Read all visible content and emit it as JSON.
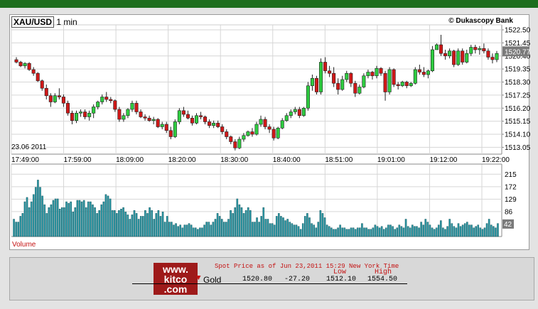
{
  "header": {
    "symbol": "XAU/USD",
    "interval": "1 min",
    "copyright": "© Dukascopy Bank",
    "date": "23.06 2011",
    "volume_label": "Volume"
  },
  "colors": {
    "up": "#2ecc40",
    "down": "#d01818",
    "volume": "#2a9aa8",
    "topbar": "#1d6e1d",
    "brand": "#9e1a1a"
  },
  "chart_data": [
    {
      "type": "candlestick",
      "title": "XAU/USD 1 min",
      "x_ticks": [
        "17:49:00",
        "17:59:00",
        "18:09:00",
        "18:20:00",
        "18:30:00",
        "18:40:00",
        "18:51:00",
        "19:01:00",
        "19:12:00",
        "19:22:00"
      ],
      "y_ticks": [
        "1522.50",
        "1521.45",
        "1520.40",
        "1519.35",
        "1518.30",
        "1517.25",
        "1516.20",
        "1515.15",
        "1514.10",
        "1513.05"
      ],
      "ylim": [
        1512.5,
        1522.9
      ],
      "last_price": "1520.77",
      "grid": true,
      "candles": [
        [
          1520.1,
          1520.3,
          1519.8,
          1519.9
        ],
        [
          1519.9,
          1520.0,
          1519.5,
          1519.6
        ],
        [
          1519.6,
          1519.9,
          1519.4,
          1519.8
        ],
        [
          1519.8,
          1519.9,
          1519.2,
          1519.3
        ],
        [
          1519.3,
          1519.5,
          1518.8,
          1519.0
        ],
        [
          1519.0,
          1519.1,
          1518.3,
          1518.4
        ],
        [
          1518.4,
          1518.5,
          1517.6,
          1517.8
        ],
        [
          1517.8,
          1518.1,
          1516.9,
          1517.2
        ],
        [
          1517.2,
          1517.4,
          1516.3,
          1516.7
        ],
        [
          1516.7,
          1517.4,
          1516.6,
          1517.2
        ],
        [
          1517.2,
          1517.8,
          1516.9,
          1517.1
        ],
        [
          1517.1,
          1517.3,
          1516.3,
          1516.6
        ],
        [
          1516.6,
          1516.8,
          1515.6,
          1515.8
        ],
        [
          1515.8,
          1516.0,
          1514.9,
          1515.2
        ],
        [
          1515.2,
          1516.0,
          1515.0,
          1515.8
        ],
        [
          1515.8,
          1516.1,
          1515.5,
          1515.9
        ],
        [
          1515.9,
          1516.1,
          1515.3,
          1515.5
        ],
        [
          1515.5,
          1516.0,
          1515.2,
          1515.8
        ],
        [
          1515.8,
          1516.5,
          1515.4,
          1516.3
        ],
        [
          1516.3,
          1516.8,
          1516.1,
          1516.7
        ],
        [
          1516.7,
          1517.3,
          1516.5,
          1517.1
        ],
        [
          1517.1,
          1517.5,
          1516.7,
          1516.9
        ],
        [
          1516.9,
          1517.1,
          1516.6,
          1516.8
        ],
        [
          1516.8,
          1516.9,
          1515.9,
          1516.1
        ],
        [
          1516.1,
          1516.3,
          1515.1,
          1515.3
        ],
        [
          1515.3,
          1515.8,
          1515.1,
          1515.6
        ],
        [
          1515.6,
          1516.2,
          1515.4,
          1516.1
        ],
        [
          1516.1,
          1516.8,
          1515.9,
          1516.6
        ],
        [
          1516.6,
          1516.8,
          1515.7,
          1515.9
        ],
        [
          1515.9,
          1516.1,
          1515.4,
          1515.5
        ],
        [
          1515.5,
          1515.7,
          1515.2,
          1515.4
        ],
        [
          1515.4,
          1515.6,
          1515.1,
          1515.2
        ],
        [
          1515.2,
          1515.5,
          1514.9,
          1515.3
        ],
        [
          1515.3,
          1515.4,
          1514.6,
          1514.7
        ],
        [
          1514.7,
          1515.1,
          1514.5,
          1514.9
        ],
        [
          1514.9,
          1515.1,
          1514.2,
          1514.4
        ],
        [
          1514.4,
          1514.7,
          1513.7,
          1513.9
        ],
        [
          1513.9,
          1515.3,
          1513.8,
          1515.1
        ],
        [
          1515.1,
          1516.2,
          1514.9,
          1516.0
        ],
        [
          1516.0,
          1516.3,
          1515.5,
          1515.7
        ],
        [
          1515.7,
          1516.0,
          1515.3,
          1515.4
        ],
        [
          1515.4,
          1515.6,
          1514.8,
          1515.0
        ],
        [
          1515.0,
          1515.8,
          1514.9,
          1515.6
        ],
        [
          1515.6,
          1515.9,
          1515.3,
          1515.5
        ],
        [
          1515.5,
          1515.6,
          1514.9,
          1515.1
        ],
        [
          1515.1,
          1515.3,
          1514.6,
          1514.8
        ],
        [
          1514.8,
          1515.2,
          1514.6,
          1515.0
        ],
        [
          1515.0,
          1515.2,
          1514.6,
          1514.7
        ],
        [
          1514.7,
          1514.9,
          1514.1,
          1514.3
        ],
        [
          1514.3,
          1514.5,
          1513.7,
          1513.9
        ],
        [
          1513.9,
          1514.0,
          1513.3,
          1513.5
        ],
        [
          1513.5,
          1513.7,
          1512.8,
          1513.0
        ],
        [
          1513.0,
          1513.9,
          1512.9,
          1513.7
        ],
        [
          1513.7,
          1514.2,
          1513.5,
          1514.0
        ],
        [
          1514.0,
          1514.4,
          1513.9,
          1514.3
        ],
        [
          1514.3,
          1514.6,
          1513.9,
          1514.1
        ],
        [
          1514.1,
          1515.1,
          1514.0,
          1514.9
        ],
        [
          1514.9,
          1515.6,
          1514.7,
          1515.3
        ],
        [
          1515.3,
          1515.5,
          1514.5,
          1514.7
        ],
        [
          1514.7,
          1514.9,
          1514.2,
          1514.5
        ],
        [
          1514.5,
          1514.7,
          1513.6,
          1513.8
        ],
        [
          1513.8,
          1514.7,
          1513.7,
          1514.6
        ],
        [
          1514.6,
          1515.4,
          1514.5,
          1515.2
        ],
        [
          1515.2,
          1515.8,
          1515.1,
          1515.6
        ],
        [
          1515.6,
          1516.1,
          1515.4,
          1515.9
        ],
        [
          1515.9,
          1516.3,
          1515.7,
          1516.1
        ],
        [
          1516.1,
          1516.3,
          1515.4,
          1515.6
        ],
        [
          1515.6,
          1516.3,
          1515.5,
          1516.2
        ],
        [
          1516.2,
          1518.3,
          1516.0,
          1518.0
        ],
        [
          1518.0,
          1518.9,
          1517.6,
          1518.6
        ],
        [
          1518.6,
          1518.8,
          1517.3,
          1517.5
        ],
        [
          1517.5,
          1520.2,
          1517.3,
          1519.9
        ],
        [
          1519.9,
          1520.3,
          1519.0,
          1519.2
        ],
        [
          1519.2,
          1519.6,
          1518.7,
          1519.0
        ],
        [
          1519.0,
          1519.5,
          1517.9,
          1518.2
        ],
        [
          1518.2,
          1518.6,
          1517.3,
          1517.7
        ],
        [
          1517.7,
          1518.8,
          1517.6,
          1518.5
        ],
        [
          1518.5,
          1519.2,
          1518.3,
          1519.0
        ],
        [
          1519.0,
          1519.1,
          1517.9,
          1518.2
        ],
        [
          1518.2,
          1518.4,
          1517.1,
          1517.4
        ],
        [
          1517.4,
          1518.1,
          1517.3,
          1517.9
        ],
        [
          1517.9,
          1519.0,
          1517.8,
          1518.8
        ],
        [
          1518.8,
          1519.3,
          1518.6,
          1519.1
        ],
        [
          1519.1,
          1519.2,
          1518.5,
          1518.8
        ],
        [
          1518.8,
          1519.6,
          1518.6,
          1519.4
        ],
        [
          1519.4,
          1519.5,
          1518.8,
          1519.0
        ],
        [
          1519.0,
          1519.2,
          1516.8,
          1517.5
        ],
        [
          1517.5,
          1519.5,
          1517.3,
          1519.3
        ],
        [
          1519.3,
          1519.4,
          1517.9,
          1518.1
        ],
        [
          1518.1,
          1518.3,
          1517.7,
          1518.0
        ],
        [
          1518.0,
          1518.4,
          1517.9,
          1518.3
        ],
        [
          1518.3,
          1518.4,
          1517.8,
          1518.0
        ],
        [
          1518.0,
          1518.3,
          1517.9,
          1518.2
        ],
        [
          1518.2,
          1519.5,
          1518.1,
          1519.3
        ],
        [
          1519.3,
          1519.7,
          1518.9,
          1519.1
        ],
        [
          1519.1,
          1519.5,
          1518.7,
          1518.9
        ],
        [
          1518.9,
          1519.3,
          1518.6,
          1519.2
        ],
        [
          1519.2,
          1521.2,
          1519.1,
          1520.9
        ],
        [
          1520.9,
          1521.4,
          1521.0,
          1521.3
        ],
        [
          1521.3,
          1522.1,
          1520.4,
          1520.6
        ],
        [
          1520.6,
          1520.9,
          1520.1,
          1520.4
        ],
        [
          1520.4,
          1521.0,
          1520.2,
          1520.8
        ],
        [
          1520.8,
          1520.9,
          1519.5,
          1519.7
        ],
        [
          1519.7,
          1521.0,
          1519.6,
          1520.8
        ],
        [
          1520.8,
          1521.0,
          1519.7,
          1519.9
        ],
        [
          1519.9,
          1520.9,
          1519.8,
          1520.6
        ],
        [
          1520.6,
          1521.3,
          1520.4,
          1521.1
        ],
        [
          1521.1,
          1521.3,
          1520.6,
          1520.9
        ],
        [
          1520.9,
          1521.2,
          1520.5,
          1521.0
        ],
        [
          1521.0,
          1521.4,
          1520.6,
          1520.8
        ],
        [
          1520.8,
          1521.0,
          1520.1,
          1520.3
        ],
        [
          1520.3,
          1520.6,
          1519.8,
          1520.1
        ],
        [
          1520.1,
          1520.8,
          1519.9,
          1520.6
        ]
      ]
    },
    {
      "type": "bar",
      "title": "Volume",
      "y_ticks": [
        "215",
        "172",
        "129",
        "86"
      ],
      "last_value": "42",
      "ylim": [
        0,
        250
      ],
      "values": [
        60,
        50,
        50,
        70,
        80,
        120,
        135,
        100,
        120,
        145,
        170,
        195,
        170,
        140,
        110,
        80,
        100,
        110,
        125,
        130,
        130,
        95,
        100,
        100,
        120,
        115,
        120,
        85,
        100,
        125,
        125,
        120,
        125,
        100,
        120,
        120,
        110,
        100,
        80,
        90,
        110,
        120,
        145,
        140,
        130,
        90,
        90,
        80,
        90,
        95,
        100,
        85,
        75,
        60,
        75,
        90,
        80,
        60,
        70,
        70,
        90,
        80,
        100,
        90,
        60,
        80,
        90,
        70,
        85,
        50,
        70,
        50,
        50,
        40,
        45,
        35,
        40,
        30,
        40,
        40,
        45,
        40,
        30,
        30,
        25,
        30,
        30,
        40,
        50,
        50,
        40,
        50,
        60,
        80,
        70,
        60,
        50,
        50,
        60,
        90,
        80,
        100,
        130,
        110,
        100,
        80,
        90,
        100,
        90,
        50,
        50,
        65,
        50,
        70,
        100,
        60,
        60,
        45,
        45,
        40,
        70,
        80,
        70,
        65,
        55,
        60,
        50,
        45,
        40,
        40,
        35,
        25,
        45,
        70,
        80,
        65,
        45,
        40,
        30,
        50,
        90,
        80,
        65,
        40,
        35,
        30,
        25,
        25,
        30,
        40,
        30,
        30,
        25,
        25,
        30,
        30,
        25,
        30,
        30,
        45,
        30,
        30,
        25,
        25,
        30,
        40,
        35,
        30,
        35,
        25,
        30,
        40,
        40,
        35,
        25,
        30,
        40,
        35,
        30,
        60,
        35,
        30,
        40,
        35,
        35,
        30,
        50,
        40,
        60,
        50,
        40,
        30,
        25,
        30,
        40,
        55,
        30,
        25,
        35,
        60,
        45,
        35,
        30,
        45,
        35,
        40,
        45,
        50,
        40,
        40,
        30,
        35,
        40,
        30,
        25,
        30,
        45,
        60,
        40,
        35,
        30,
        45
      ]
    }
  ],
  "footer": {
    "logo_line1": "www.",
    "logo_line2": "kitco",
    "logo_line3": ".com",
    "spot_text": "Spot Price as of Jun 23,2011 15:29 New York Time",
    "low_label": "Low",
    "high_label": "High",
    "metal": "Gold",
    "price": "1520.80",
    "change": "-27.20",
    "low": "1512.10",
    "high": "1554.50"
  }
}
